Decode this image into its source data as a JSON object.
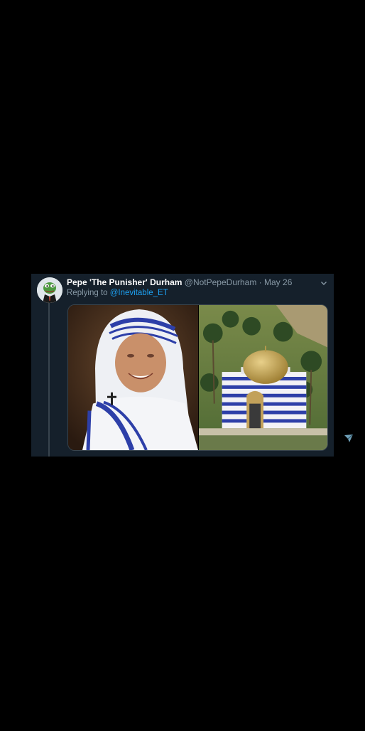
{
  "tweet": {
    "display_name": "Pepe 'The Punisher' Durham",
    "handle": "@NotPepeDurham",
    "separator": "·",
    "date": "May 26",
    "reply_prefix": "Replying to",
    "reply_handle": "@Inevitable_ET"
  },
  "icons": {
    "avatar": "pepe-avatar",
    "more": "chevron-down-icon",
    "corner": "paper-plane-icon"
  },
  "colors": {
    "background": "#000000",
    "card": "#15202b",
    "link": "#1da1f2",
    "secondary_text": "#8899a6"
  }
}
